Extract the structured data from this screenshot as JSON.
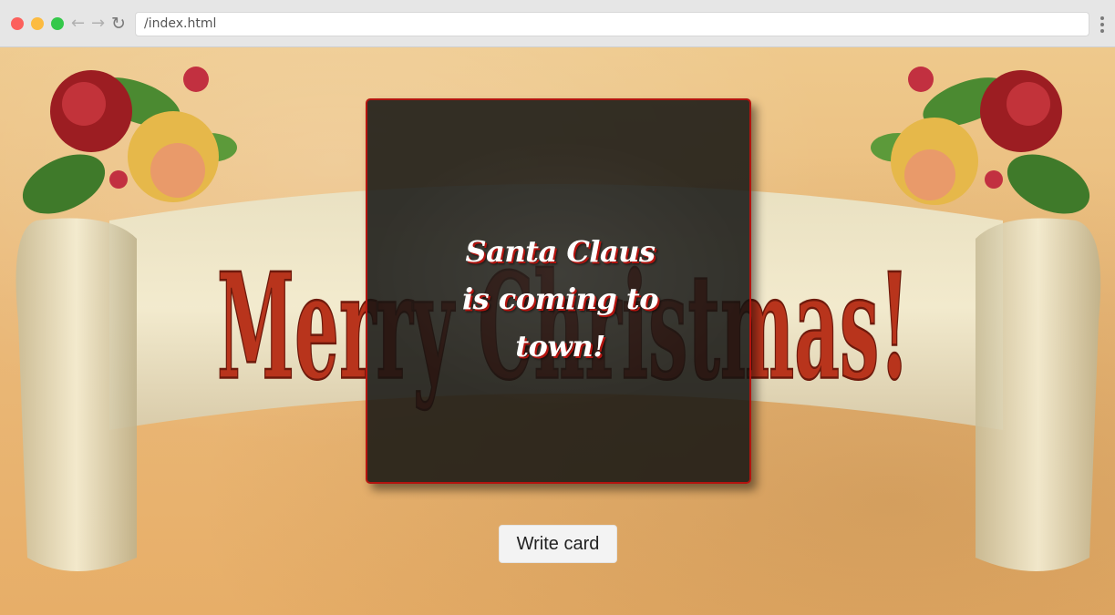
{
  "browser": {
    "url": "/index.html"
  },
  "background": {
    "banner_text": "Merry Christmas!"
  },
  "card": {
    "message": "Santa Claus is coming to town!",
    "border_color": "#b3140f"
  },
  "actions": {
    "write_card_label": "Write card"
  }
}
